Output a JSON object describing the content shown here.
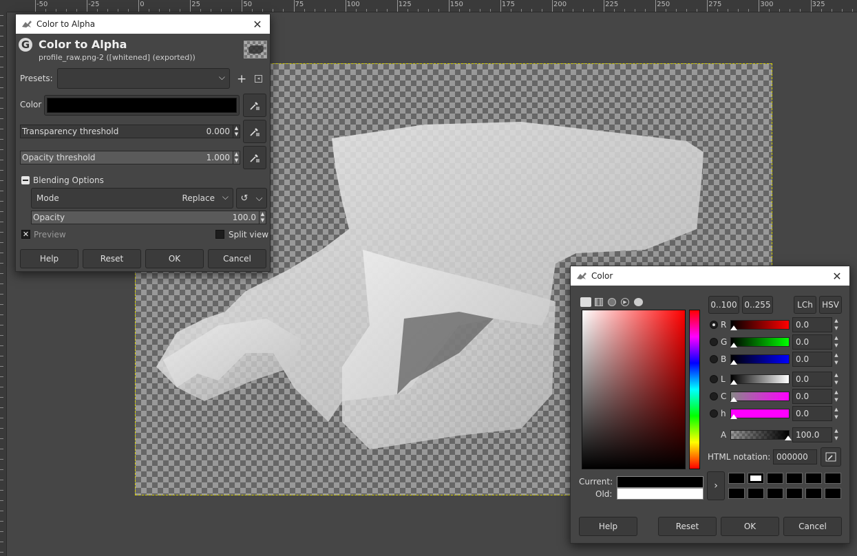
{
  "ruler": {
    "labels": [
      "-50",
      "-25",
      "0",
      "25",
      "50",
      "75",
      "100",
      "125",
      "150",
      "175",
      "200",
      "225",
      "250",
      "275",
      "300",
      "325"
    ]
  },
  "color_to_alpha": {
    "window_title": "Color to Alpha",
    "header_title": "Color to Alpha",
    "header_subtitle": "profile_raw.png-2 ([whitened] (exported))",
    "presets_label": "Presets:",
    "presets_value": "",
    "color_label": "Color",
    "color_value": "#000000",
    "transparency_label": "Transparency threshold",
    "transparency_value": "0.000",
    "opacity_threshold_label": "Opacity threshold",
    "opacity_threshold_value": "1.000",
    "blending_label": "Blending Options",
    "mode_label": "Mode",
    "mode_value": "Replace",
    "opacity_label": "Opacity",
    "opacity_value": "100.0",
    "preview_label": "Preview",
    "preview_checked": true,
    "split_view_label": "Split view",
    "split_view_checked": false,
    "buttons": {
      "help": "Help",
      "reset": "Reset",
      "ok": "OK",
      "cancel": "Cancel"
    }
  },
  "color_dialog": {
    "window_title": "Color",
    "range_buttons": [
      "0..100",
      "0..255"
    ],
    "model_buttons": [
      "LCh",
      "HSV"
    ],
    "channels": [
      {
        "key": "R",
        "value": "0.0",
        "selected": true
      },
      {
        "key": "G",
        "value": "0.0",
        "selected": false
      },
      {
        "key": "B",
        "value": "0.0",
        "selected": false
      },
      {
        "key": "L",
        "value": "0.0",
        "selected": false
      },
      {
        "key": "C",
        "value": "0.0",
        "selected": false
      },
      {
        "key": "h",
        "value": "0.0",
        "selected": false
      }
    ],
    "alpha_label": "A",
    "alpha_value": "100.0",
    "html_notation_label": "HTML notation:",
    "html_notation_value": "000000",
    "current_label": "Current:",
    "old_label": "Old:",
    "current_color": "#000000",
    "old_color": "#ffffff",
    "buttons": {
      "help": "Help",
      "reset": "Reset",
      "ok": "OK",
      "cancel": "Cancel"
    }
  },
  "colors": {
    "canvas_bg": "#464646",
    "dialog_bg": "#454545",
    "selection_border": "#d9d300"
  }
}
